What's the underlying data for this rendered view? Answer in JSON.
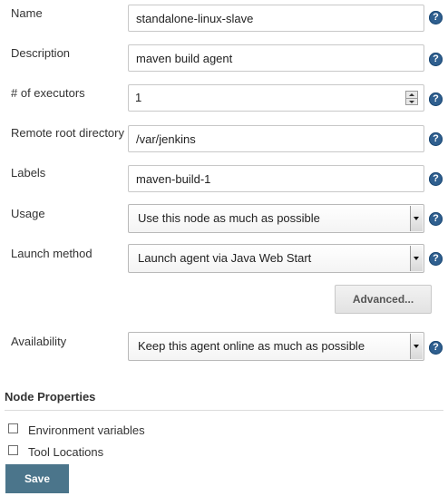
{
  "fields": {
    "name": {
      "label": "Name",
      "value": "standalone-linux-slave"
    },
    "description": {
      "label": "Description",
      "value": "maven build agent"
    },
    "executors": {
      "label": "# of executors",
      "value": "1"
    },
    "remote_root": {
      "label": "Remote root directory",
      "value": "/var/jenkins"
    },
    "labels": {
      "label": "Labels",
      "value": "maven-build-1"
    },
    "usage": {
      "label": "Usage",
      "value": "Use this node as much as possible"
    },
    "launch": {
      "label": "Launch method",
      "value": "Launch agent via Java Web Start"
    },
    "availability": {
      "label": "Availability",
      "value": "Keep this agent online as much as possible"
    }
  },
  "advanced_label": "Advanced...",
  "help_glyph": "?",
  "node_properties": {
    "title": "Node Properties",
    "items": [
      {
        "label": "Environment variables",
        "checked": false
      },
      {
        "label": "Tool Locations",
        "checked": false
      }
    ]
  },
  "save_label": "Save",
  "colors": {
    "save_button": "#4b758b",
    "help_icon": "#2f5f8f"
  }
}
